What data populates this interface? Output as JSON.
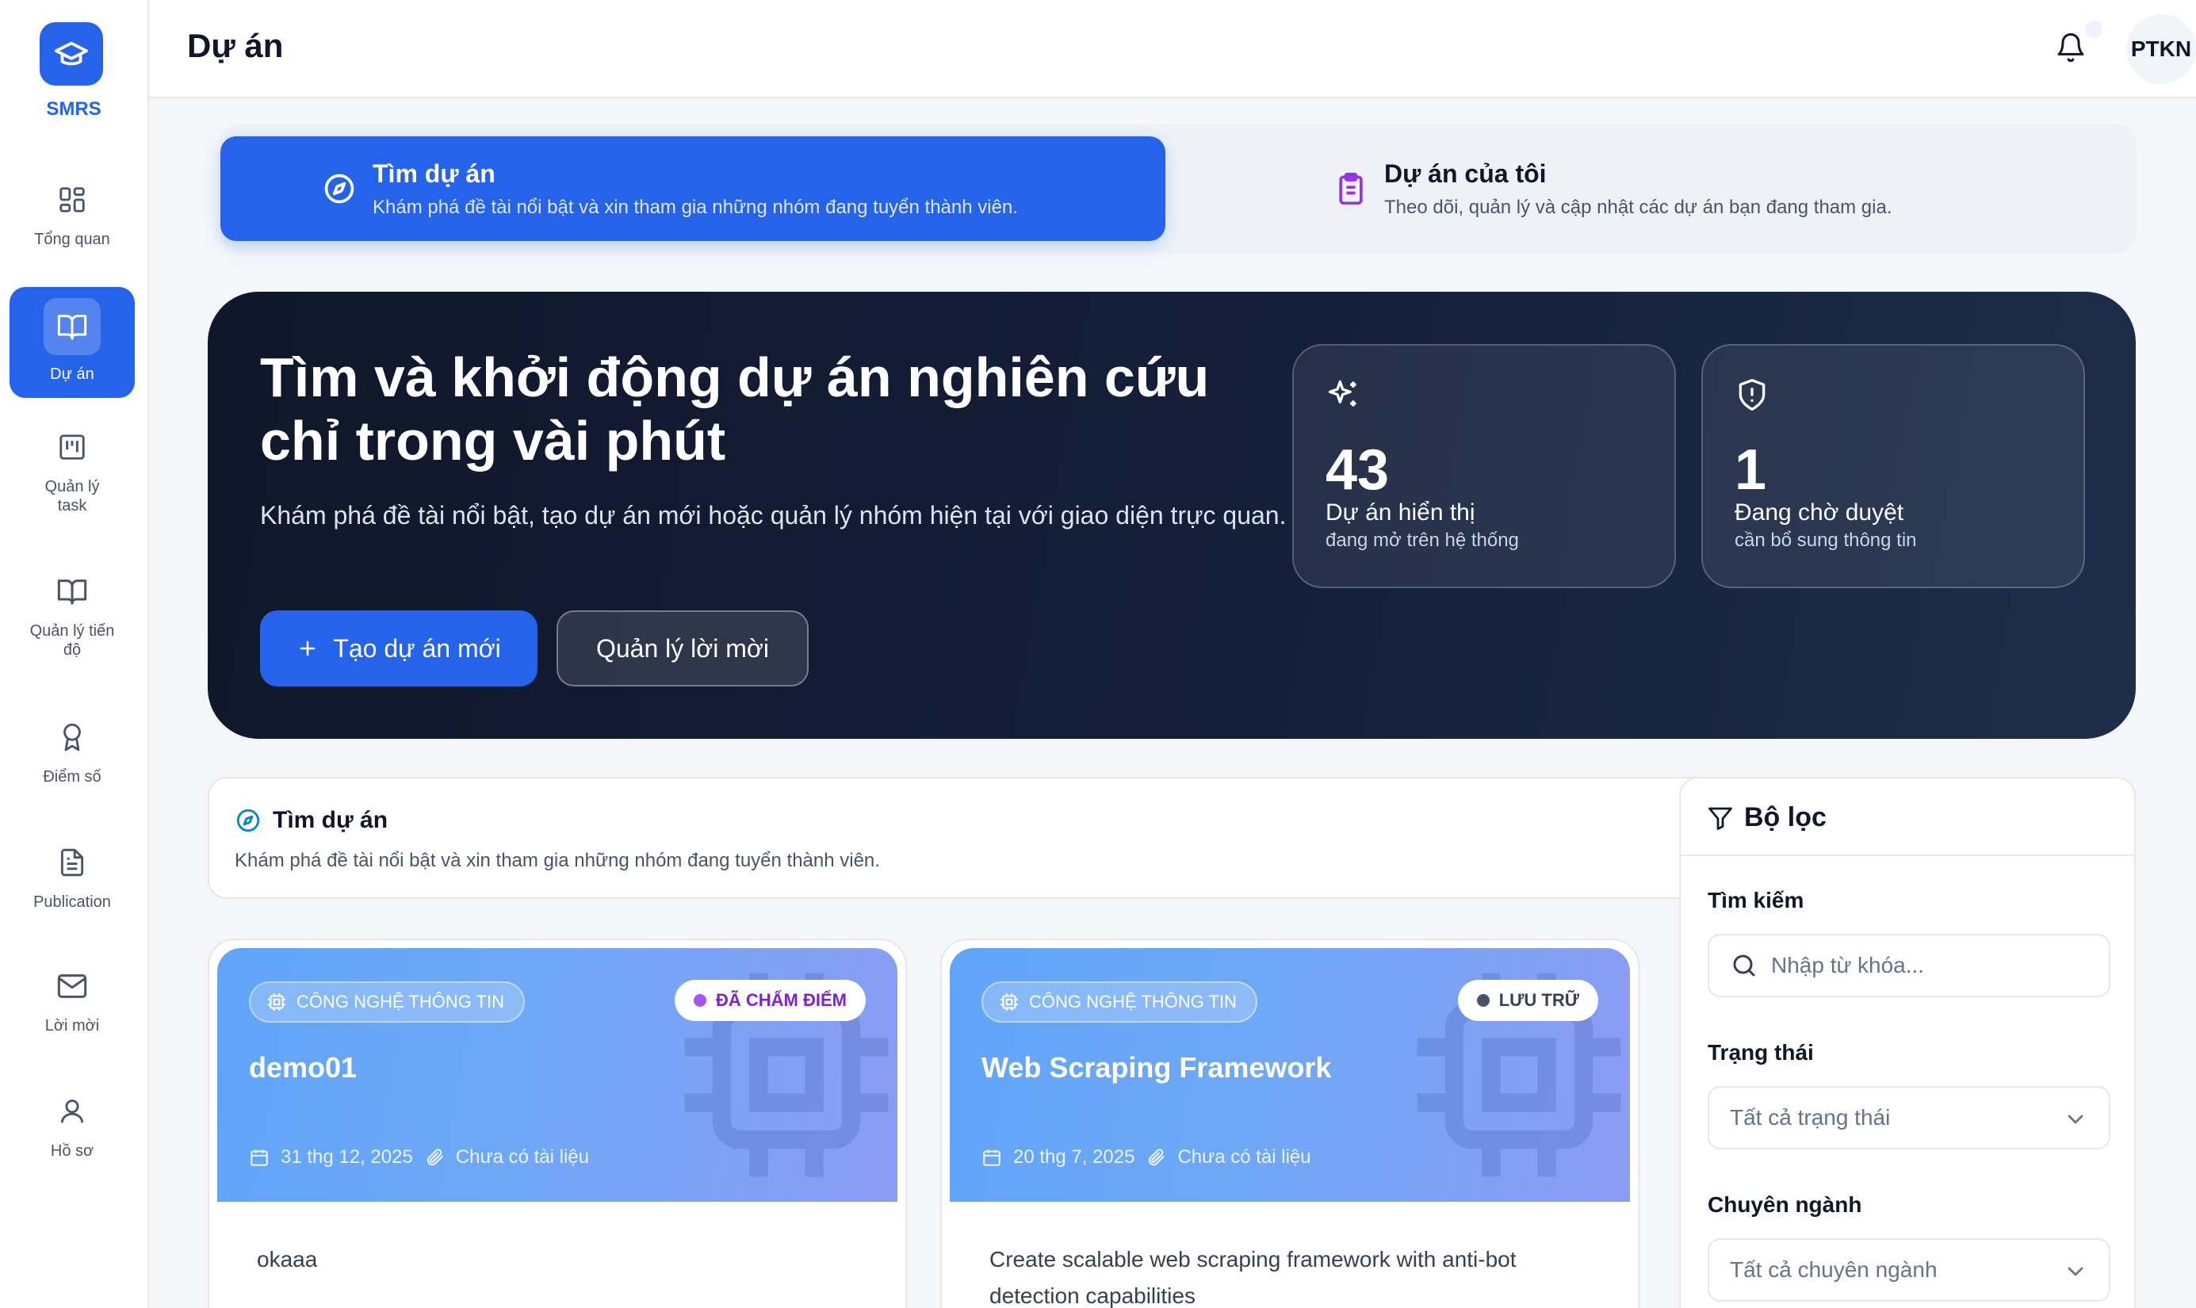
{
  "app": {
    "logo_text": "SMRS"
  },
  "sidebar": {
    "items": [
      {
        "label": "Tổng quan",
        "icon": "grid-icon"
      },
      {
        "label": "Dự án",
        "icon": "book-open-icon",
        "active": true
      },
      {
        "label": "Quản lý task",
        "icon": "kanban-icon"
      },
      {
        "label": "Quản lý tiến độ",
        "icon": "book-icon"
      },
      {
        "label": "Điểm số",
        "icon": "award-icon"
      },
      {
        "label": "Publication",
        "icon": "file-text-icon"
      },
      {
        "label": "Lời mời",
        "icon": "mail-icon"
      },
      {
        "label": "Hồ sơ",
        "icon": "user-icon"
      }
    ]
  },
  "header": {
    "title": "Dự án",
    "user_initials": "PTKN"
  },
  "tabs": [
    {
      "title": "Tìm dự án",
      "desc": "Khám phá đề tài nổi bật và xin tham gia những nhóm đang tuyển thành viên.",
      "icon": "compass-icon"
    },
    {
      "title": "Dự án của tôi",
      "desc": "Theo dõi, quản lý và cập nhật các dự án bạn đang tham gia.",
      "icon": "clipboard-icon"
    }
  ],
  "hero": {
    "title": "Tìm và khởi động dự án nghiên cứu chỉ trong vài phút",
    "subtitle": "Khám phá đề tài nổi bật, tạo dự án mới hoặc quản lý nhóm hiện tại với giao diện trực quan.",
    "primary_button": "Tạo dự án mới",
    "secondary_button": "Quản lý lời mời",
    "stats": [
      {
        "value": "43",
        "label": "Dự án hiển thị",
        "sub": "đang mở trên hệ thống",
        "icon": "sparkles-icon"
      },
      {
        "value": "1",
        "label": "Đang chờ duyệt",
        "sub": "cần bổ sung thông tin",
        "icon": "shield-alert-icon"
      }
    ]
  },
  "find_section": {
    "title": "Tìm dự án",
    "desc": "Khám phá đề tài nổi bật và xin tham gia những nhóm đang tuyển thành viên."
  },
  "projects": [
    {
      "category": "CÔNG NGHỆ THÔNG TIN",
      "status": "ĐÃ CHẤM ĐIỂM",
      "status_color": "#9333ea",
      "status_text_color": "#7e22ce",
      "title": "demo01",
      "date": "31 thg 12, 2025",
      "docs": "Chưa có tài liệu",
      "description": "okaaa"
    },
    {
      "category": "CÔNG NGHỆ THÔNG TIN",
      "status": "LƯU TRỮ",
      "status_color": "#475569",
      "status_text_color": "#334155",
      "title": "Web Scraping Framework",
      "date": "20 thg 7, 2025",
      "docs": "Chưa có tài liệu",
      "description": "Create scalable web scraping framework with anti-bot detection capabilities"
    }
  ],
  "filter": {
    "title": "Bộ lọc",
    "search_label": "Tìm kiếm",
    "search_placeholder": "Nhập từ khóa...",
    "status_label": "Trạng thái",
    "status_value": "Tất cả trạng thái",
    "major_label": "Chuyên ngành",
    "major_value": "Tất cả chuyên ngành"
  }
}
